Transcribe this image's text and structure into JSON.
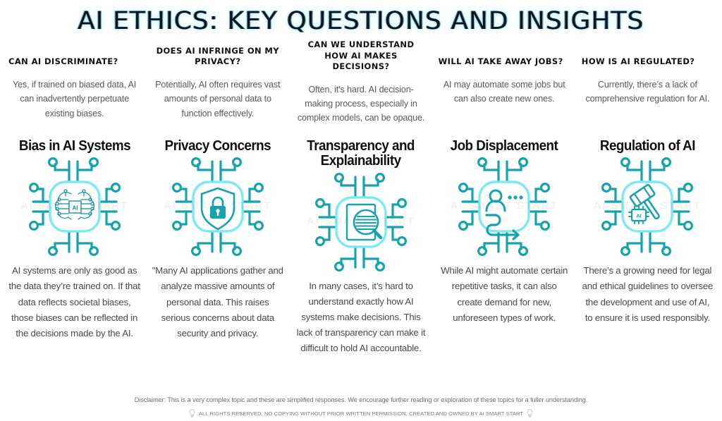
{
  "title": "AI ETHICS: KEY QUESTIONS AND INSIGHTS",
  "colors": {
    "teal": "#17a3ae",
    "teal_dark": "#0f8d99",
    "cyan_glow": "#7fe8f5",
    "title_text": "#0b1420",
    "body_text": "#4a4a4a",
    "heading_text": "#111111"
  },
  "watermark_text": "AI SMART START",
  "columns": [
    {
      "question": "CAN AI DISCRIMINATE?",
      "answer": "Yes, if trained on biased data, AI can inadvertently perpetuate existing biases.",
      "heading": "Bias in AI Systems",
      "icon": "ai-brain-chip-icon",
      "body": "AI systems are only as good as the data they’re trained on. If that data reflects societal biases, those biases can be reflected in the decisions made by the AI."
    },
    {
      "question": "DOES AI INFRINGE ON MY PRIVACY?",
      "answer": "Potentially, AI often requires vast amounts of personal data to function effectively.",
      "heading": "Privacy Concerns",
      "icon": "shield-lock-icon",
      "body": "\"Many AI applications gather and analyze massive amounts of personal data. This raises serious concerns about data security and privacy."
    },
    {
      "question": "CAN WE UNDERSTAND HOW AI MAKES DECISIONS?",
      "answer": "Often, it’s hard. AI decision-making process, especially in complex models, can be opaque.",
      "heading": "Transparency and Explainability",
      "icon": "document-magnifier-icon",
      "body": "In many cases, it’s hard to understand exactly how AI systems make decisions. This lack of transparency can make it difficult to hold AI accountable."
    },
    {
      "question": "WILL AI TAKE AWAY JOBS?",
      "answer": "AI may automate some jobs but can also create new ones.",
      "heading": "Job Displacement",
      "icon": "person-path-arrow-icon",
      "body": "While AI might automate certain repetitive tasks, it can also create demand for new, unforeseen types of work."
    },
    {
      "question": "HOW IS AI REGULATED?",
      "answer": "Currently, there’s a lack of comprehensive regulation for AI.",
      "heading": "Regulation of AI",
      "icon": "gavel-chip-icon",
      "body": "There’s a growing need for legal and ethical guidelines to oversee the development and use of AI, to ensure it is used responsibly."
    }
  ],
  "footer": {
    "disclaimer": "Disclaimer: This is a very complex topic and these are simplified responses. We encourage further reading or exploration of these topics for a fuller understanding.",
    "copyright": "ALL RIGHTS RESERVED, NO COPYING WITHOUT PRIOR WRITTEN PERMISSION, CREATED AND OWNED BY AI SMART START"
  }
}
